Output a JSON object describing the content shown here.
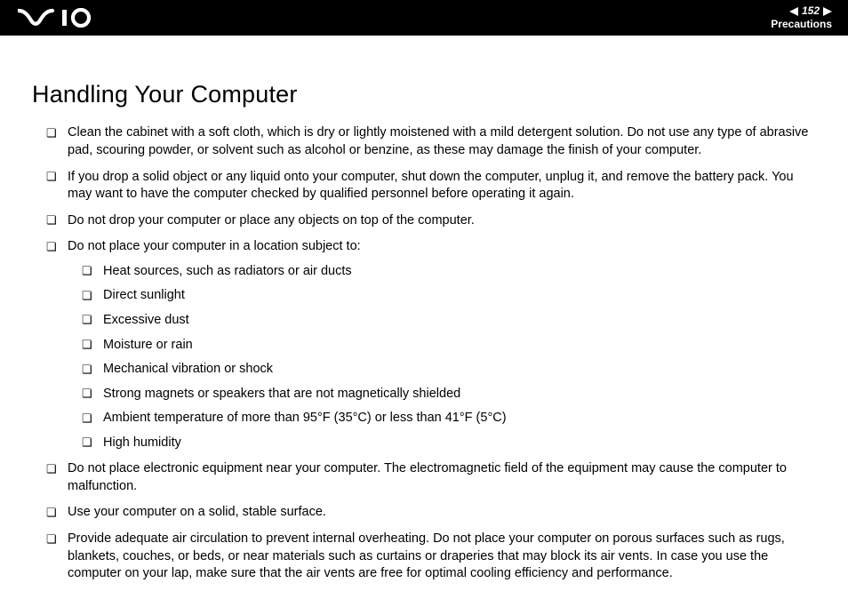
{
  "header": {
    "page_number": "152",
    "section": "Precautions"
  },
  "title": "Handling Your Computer",
  "bullets": {
    "b0": "Clean the cabinet with a soft cloth, which is dry or lightly moistened with a mild detergent solution. Do not use any type of abrasive pad, scouring powder, or solvent such as alcohol or benzine, as these may damage the finish of your computer.",
    "b1": "If you drop a solid object or any liquid onto your computer, shut down the computer, unplug it, and remove the battery pack. You may want to have the computer checked by qualified personnel before operating it again.",
    "b2": "Do not drop your computer or place any objects on top of the computer.",
    "b3": "Do not place your computer in a location subject to:",
    "b4": "Do not place electronic equipment near your computer. The electromagnetic field of the equipment may cause the computer to malfunction.",
    "b5": "Use your computer on a solid, stable surface.",
    "b6": "Provide adequate air circulation to prevent internal overheating. Do not place your computer on porous surfaces such as rugs, blankets, couches, or beds, or near materials such as curtains or draperies that may block its air vents. In case you use the computer on your lap, make sure that the air vents are free for optimal cooling efficiency and performance."
  },
  "sub": {
    "s0": "Heat sources, such as radiators or air ducts",
    "s1": "Direct sunlight",
    "s2": "Excessive dust",
    "s3": "Moisture or rain",
    "s4": "Mechanical vibration or shock",
    "s5": "Strong magnets or speakers that are not magnetically shielded",
    "s6": "Ambient temperature of more than 95°F (35°C) or less than 41°F (5°C)",
    "s7": "High humidity"
  }
}
